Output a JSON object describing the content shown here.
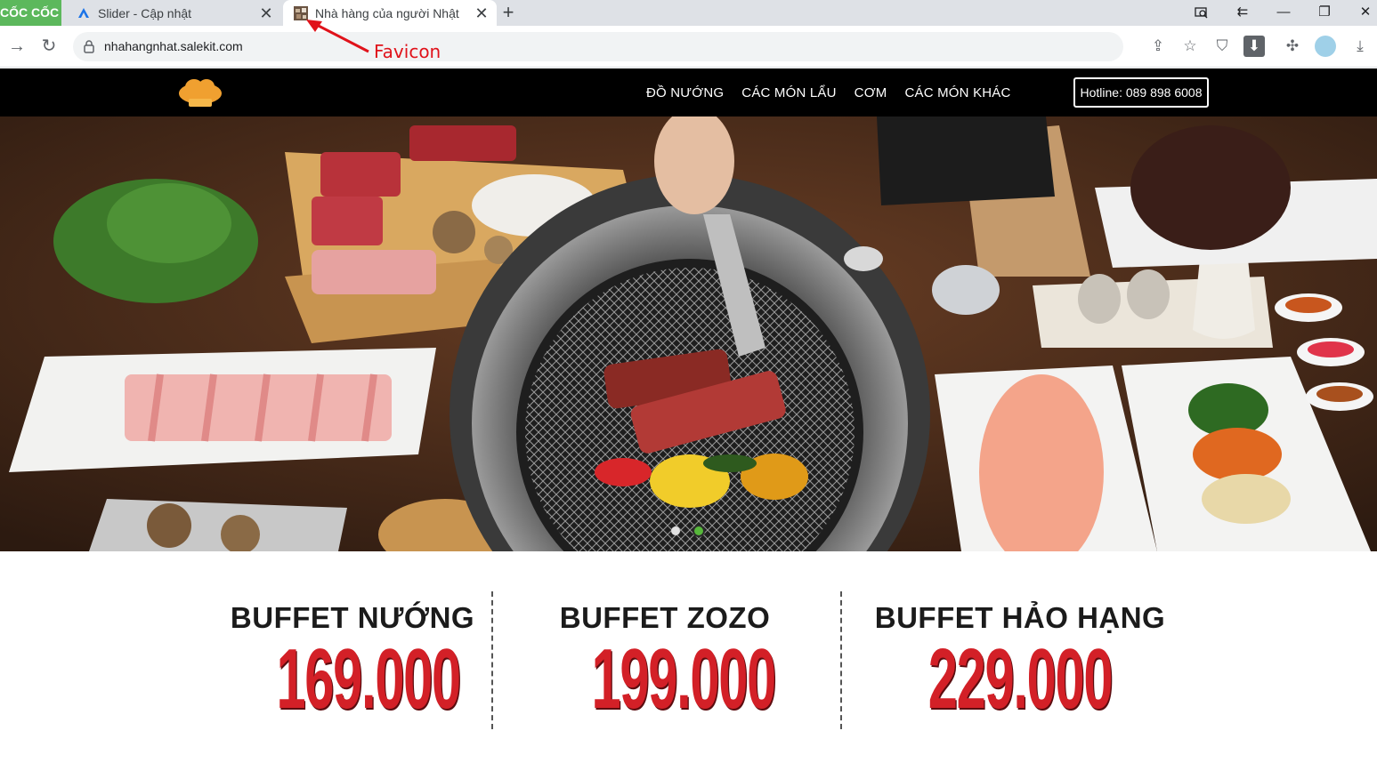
{
  "browser": {
    "brand": "CỐC CỐC",
    "tabs": [
      {
        "title": "Slider - Cập nhật",
        "active": false
      },
      {
        "title": "Nhà hàng của người Nhật",
        "active": true
      }
    ],
    "url": "nhahangnhat.salekit.com",
    "annotation": "Favicon",
    "annotation_color": "#e0121a"
  },
  "site": {
    "menu": [
      "ĐỒ NƯỚNG",
      "CÁC MÓN LẨU",
      "CƠM",
      "CÁC MÓN KHÁC"
    ],
    "hotline": "Hotline: 089 898 6008",
    "slider": {
      "slides": 2,
      "active_slide": 2,
      "active_color": "#57b73b"
    },
    "pricing": [
      {
        "name": "BUFFET NƯỚNG",
        "price": "169.000"
      },
      {
        "name": "BUFFET ZOZO",
        "price": "199.000"
      },
      {
        "name": "BUFFET HẢO HẠNG",
        "price": "229.000"
      }
    ],
    "price_color": "#d32027"
  }
}
